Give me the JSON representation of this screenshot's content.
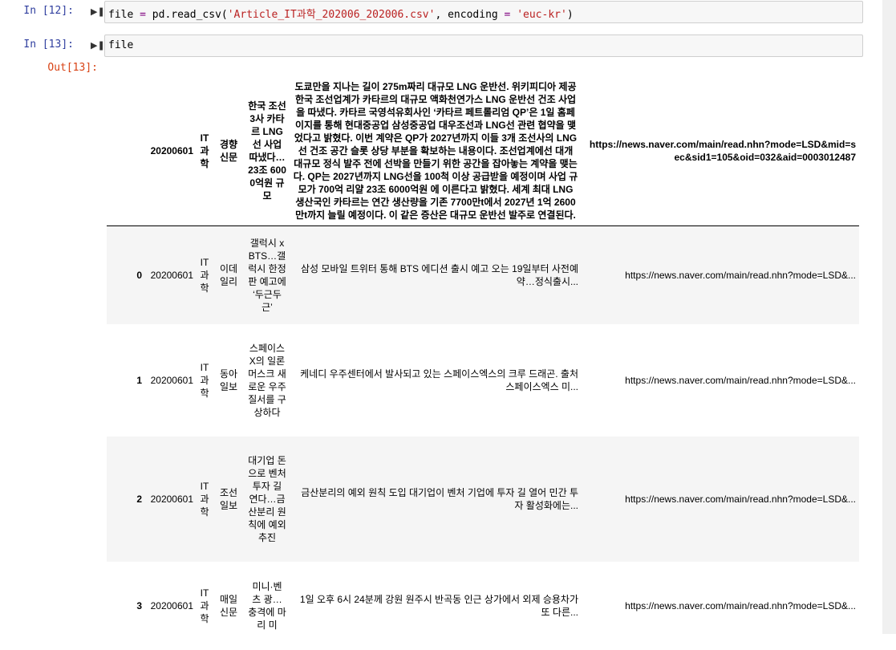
{
  "cells": {
    "in12": {
      "prompt": "In [12]:",
      "code": {
        "t1": "file",
        "t2": " = ",
        "t3": "pd.read_csv(",
        "t4": "'Article_IT과학_202006_202006.csv'",
        "t5": ", encoding ",
        "t6": "=",
        "t7": " ",
        "t8": "'euc-kr'",
        "t9": ")"
      }
    },
    "in13": {
      "prompt": "In [13]:",
      "code": "file"
    },
    "out13": {
      "prompt": "Out[13]:"
    }
  },
  "dataframe": {
    "header": {
      "index": "",
      "date": "20200601",
      "category": "IT 과학",
      "press": "경향 신문",
      "title": "한국 조선3사 카타르 LNG선 사업 따냈다… 23조 6000억원 규모",
      "content": "도쿄만을 지나는 길이 275m짜리 대규모 LNG 운반선. 위키피디아 제공 한국 조선업계가 카타르의 대규모 액화천연가스 LNG 운반선 건조 사업을 따냈다. 카타르 국영석유회사인 ‘카타르 페트롤리엄 QP’은 1일 홈페이지를 통해 현대중공업 삼성중공업 대우조선과 LNG선 관련 협약을 맺었다고 밝혔다. 이번 계약은 QP가 2027년까지 이들 3개 조선사의 LNG선 건조 공간 슬롯 상당 부분을 확보하는 내용이다. 조선업계에선 대개 대규모 정식 발주 전에 선박을 만들기 위한 공간을 잡아놓는 계약을 맺는다. QP는 2027년까지 LNG선을 100척 이상 공급받을 예정이며 사업 규모가 700억 리얄 23조 6000억원 에 이른다고 밝혔다. 세계 최대 LNG 생산국인 카타르는 연간 생산량을 기존 7700만t에서 2027년 1억 2600만t까지 늘릴 예정이다. 이 같은 증산은 대규모 운반선 발주로 연결된다.",
      "url": "https://news.naver.com/main/read.nhn?mode=LSD&mid=sec&sid1=105&oid=032&aid=0003012487"
    },
    "rows": [
      {
        "index": "0",
        "date": "20200601",
        "category": "IT 과학",
        "press": "이데 일리",
        "title": "갤럭시 xBTS…갤럭시 한정판 예고에 ‘두근두근’",
        "content": "삼성 모바일 트위터 통해 BTS 에디션 출시 예고 오는 19일부터 사전예약…정식출시...",
        "url": "https://news.naver.com/main/read.nhn?mode=LSD&..."
      },
      {
        "index": "1",
        "date": "20200601",
        "category": "IT 과학",
        "press": "동아 일보",
        "title": "스페이스X의 일론 머스크 새로운 우주 질서를 구상하다",
        "content": "케네디 우주센터에서 발사되고 있는 스페이스엑스의 크루 드래곤. 출처 스페이스엑스 미...",
        "url": "https://news.naver.com/main/read.nhn?mode=LSD&..."
      },
      {
        "index": "2",
        "date": "20200601",
        "category": "IT 과학",
        "press": "조선 일보",
        "title": "대기업 돈으로 벤처 투자 길 연다…금산분리 원칙에 예외 추진",
        "content": "금산분리의 예외 원칙 도입 대기업이 벤처 기업에 투자 길 열어 민간 투자 활성화에는...",
        "url": "https://news.naver.com/main/read.nhn?mode=LSD&..."
      },
      {
        "index": "3",
        "date": "20200601",
        "category": "IT 과학",
        "press": "매일 신문",
        "title": "미니·벤츠 광… 충격에 마리 미",
        "content": "1일 오후 6시 24분께 강원 원주시 반곡동 인근 상가에서 외제 승용차가 또 다른...",
        "url": "https://news.naver.com/main/read.nhn?mode=LSD&..."
      }
    ]
  }
}
